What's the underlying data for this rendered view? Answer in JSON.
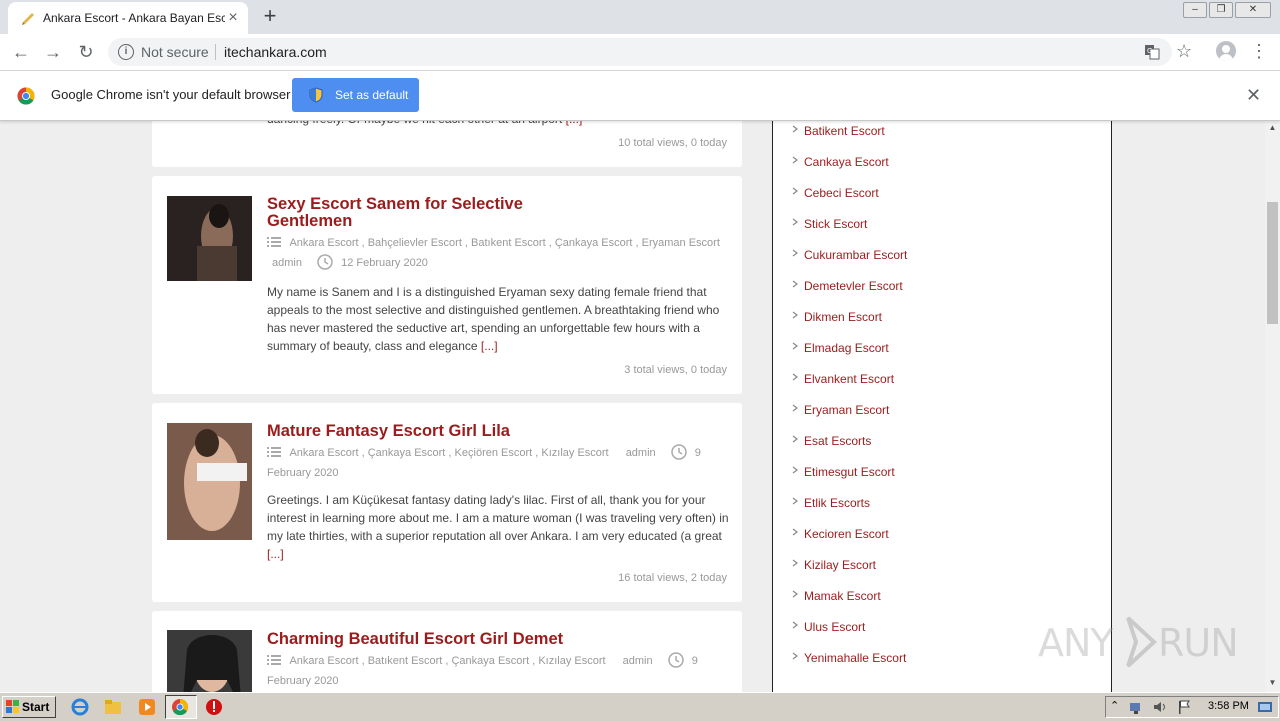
{
  "browser": {
    "tab_title": "Ankara Escort - Ankara Bayan Escort",
    "new_tab_symbol": "+",
    "security_label": "Not secure",
    "url": "itechankara.com"
  },
  "infobar": {
    "message": "Google Chrome isn't your default browser",
    "button_label": "Set as default"
  },
  "posts": [
    {
      "excerpt_end": "dancing freely. Or maybe we hit each other at an airport",
      "more": "[...]",
      "views": "10 total views, 0 today"
    },
    {
      "title": "Sexy Escort Sanem for Selective Gentlemen",
      "categories": [
        "Ankara Escort",
        "Bahçelievler Escort",
        "Batıkent Escort",
        "Çankaya Escort",
        "Eryaman Escort"
      ],
      "author": "admin",
      "date": "12 February 2020",
      "excerpt": "My name is Sanem and I is a distinguished Eryaman sexy dating female friend that appeals to the most selective and distinguished gentlemen. A breathtaking friend who has never mastered the seductive art, spending an unforgettable few hours with a summary of beauty, class and elegance",
      "more": "[...]",
      "views": "3 total views, 0 today"
    },
    {
      "title": "Mature Fantasy Escort Girl Lila",
      "categories": [
        "Ankara Escort",
        "Çankaya Escort",
        "Keçiören Escort",
        "Kızılay Escort"
      ],
      "author": "admin",
      "date_part1": "9",
      "date_part2": "February 2020",
      "excerpt": "Greetings. I am Küçükesat fantasy dating lady's lilac. First of all, thank you for your interest in learning more about me. I am a mature woman (I was traveling very often) in my late thirties, with a superior reputation all over Ankara. I am very educated (a great",
      "more": "[...]",
      "views": "16 total views, 2 today"
    },
    {
      "title": "Charming Beautiful Escort Girl Demet",
      "categories": [
        "Ankara Escort",
        "Batıkent Escort",
        "Çankaya Escort",
        "Kızılay Escort"
      ],
      "author": "admin",
      "date_part1": "9",
      "date_part2": "February 2020"
    }
  ],
  "sidebar": {
    "items": [
      "Batikent Escort",
      "Cankaya Escort",
      "Cebeci Escort",
      "Stick Escort",
      "Cukurambar Escort",
      "Demetevler Escort",
      "Dikmen Escort",
      "Elmadag Escort",
      "Elvankent Escort",
      "Eryaman Escort",
      "Esat Escorts",
      "Etimesgut Escort",
      "Etlik Escorts",
      "Kecioren Escort",
      "Kizilay Escort",
      "Mamak Escort",
      "Ulus Escort",
      "Yenimahalle Escort"
    ]
  },
  "taskbar": {
    "start_label": "Start",
    "clock": "3:58 PM"
  },
  "watermark": "ANY RUN",
  "colors": {
    "link_red": "#9b1c1c",
    "button_blue": "#4d8ef0",
    "page_bg": "#eeeeee"
  }
}
